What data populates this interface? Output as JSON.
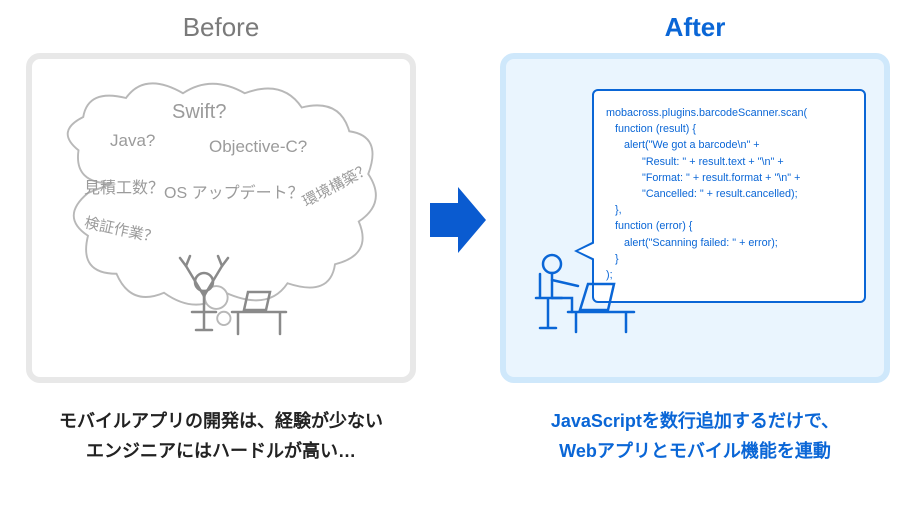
{
  "before": {
    "title": "Before",
    "caption_line1": "モバイルアプリの開発は、経験が少ない",
    "caption_line2": "エンジニアにはハードルが高い…",
    "worries": {
      "swift": "Swift?",
      "java": "Java?",
      "objc": "Objective-C?",
      "mitsumori": "見積工数？",
      "os_update": "OS アップデート？",
      "kankyo": "環境構築？",
      "kensho": "検証作業？"
    }
  },
  "after": {
    "title": "After",
    "caption_line1": "JavaScriptを数行追加するだけで、",
    "caption_line2": "Webアプリとモバイル機能を連動",
    "code": "mobacross.plugins.barcodeScanner.scan(\n   function (result) {\n      alert(\"We got a barcode\\n\" +\n            \"Result: \" + result.text + \"\\n\" +\n            \"Format: \" + result.format + \"\\n\" +\n            \"Cancelled: \" + result.cancelled);\n   },\n   function (error) {\n      alert(\"Scanning failed: \" + error);\n   }\n);"
  },
  "colors": {
    "blue": "#0a66d6",
    "gray": "#9b9b9b"
  }
}
